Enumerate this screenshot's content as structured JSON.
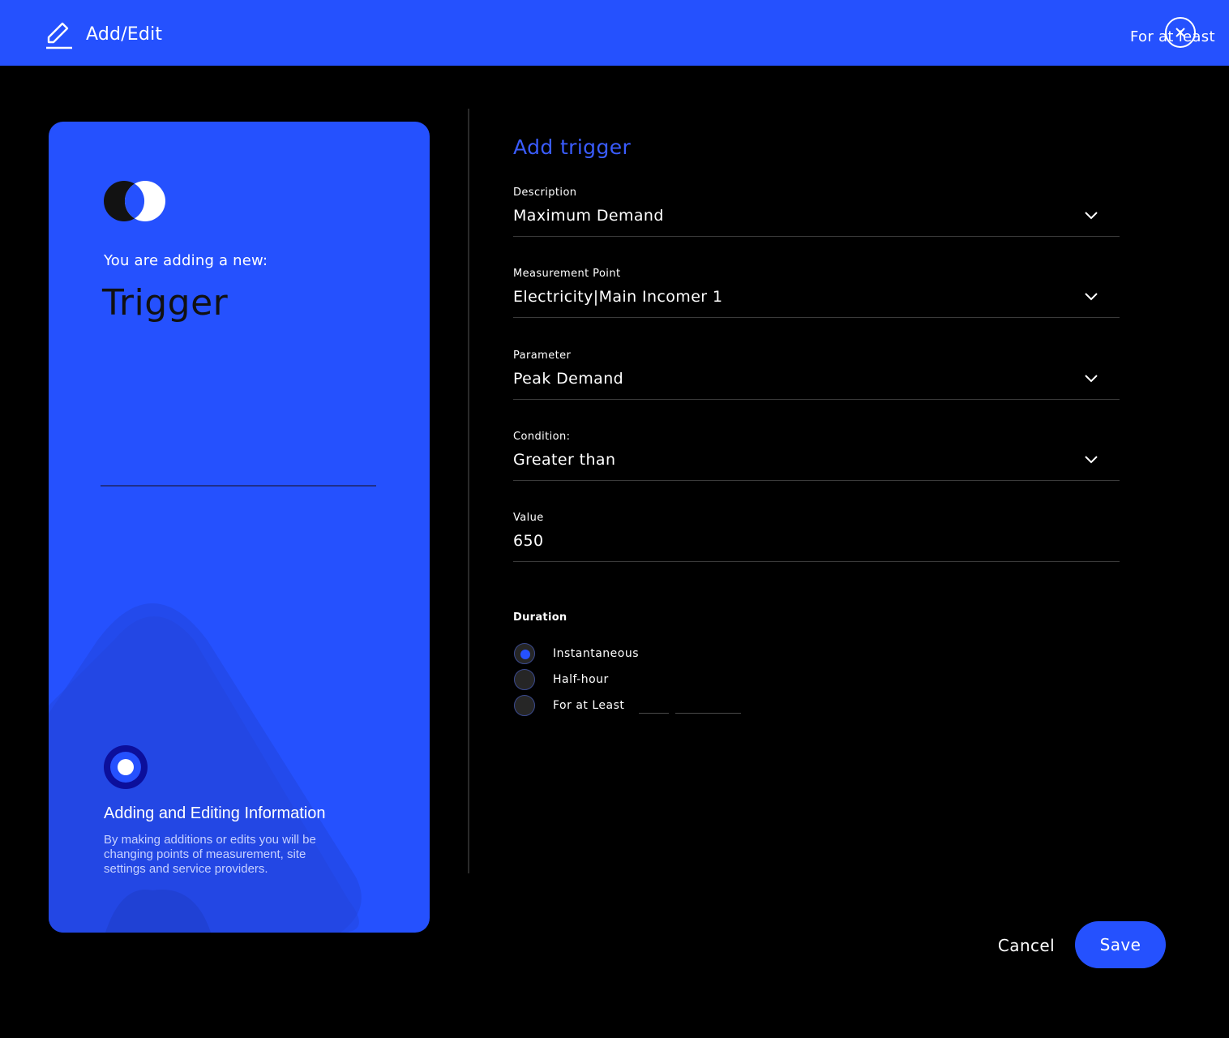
{
  "header": {
    "title": "Add/Edit",
    "right_text": "For at least"
  },
  "card": {
    "adding_label": "You are adding a new:",
    "entity_name": "Trigger",
    "info_title": "Adding and Editing Information",
    "info_text": "By making additions or edits you will be changing points of measurement, site settings and service providers."
  },
  "form": {
    "title": "Add trigger",
    "fields": [
      {
        "label": "Description",
        "value": "Maximum Demand"
      },
      {
        "label": "Measurement Point",
        "value": "Electricity|Main Incomer 1"
      },
      {
        "label": "Parameter",
        "value": "Peak Demand"
      },
      {
        "label": "Condition:",
        "value": "Greater than"
      },
      {
        "label": "Value",
        "value": "650"
      }
    ],
    "duration": {
      "title": "Duration",
      "options": [
        {
          "label": "Instantaneous",
          "selected": true
        },
        {
          "label": "Half-hour",
          "selected": false
        },
        {
          "label": "For at Least",
          "selected": false
        }
      ]
    }
  },
  "actions": {
    "cancel_label": "Cancel",
    "save_label": "Save"
  },
  "colors": {
    "accent": "#2551fe",
    "background": "#000000",
    "title_blue": "#3a5cff"
  },
  "icons": [
    "edit-icon",
    "close-icon",
    "logo-icon",
    "info-icon",
    "chevron-down-icon"
  ]
}
